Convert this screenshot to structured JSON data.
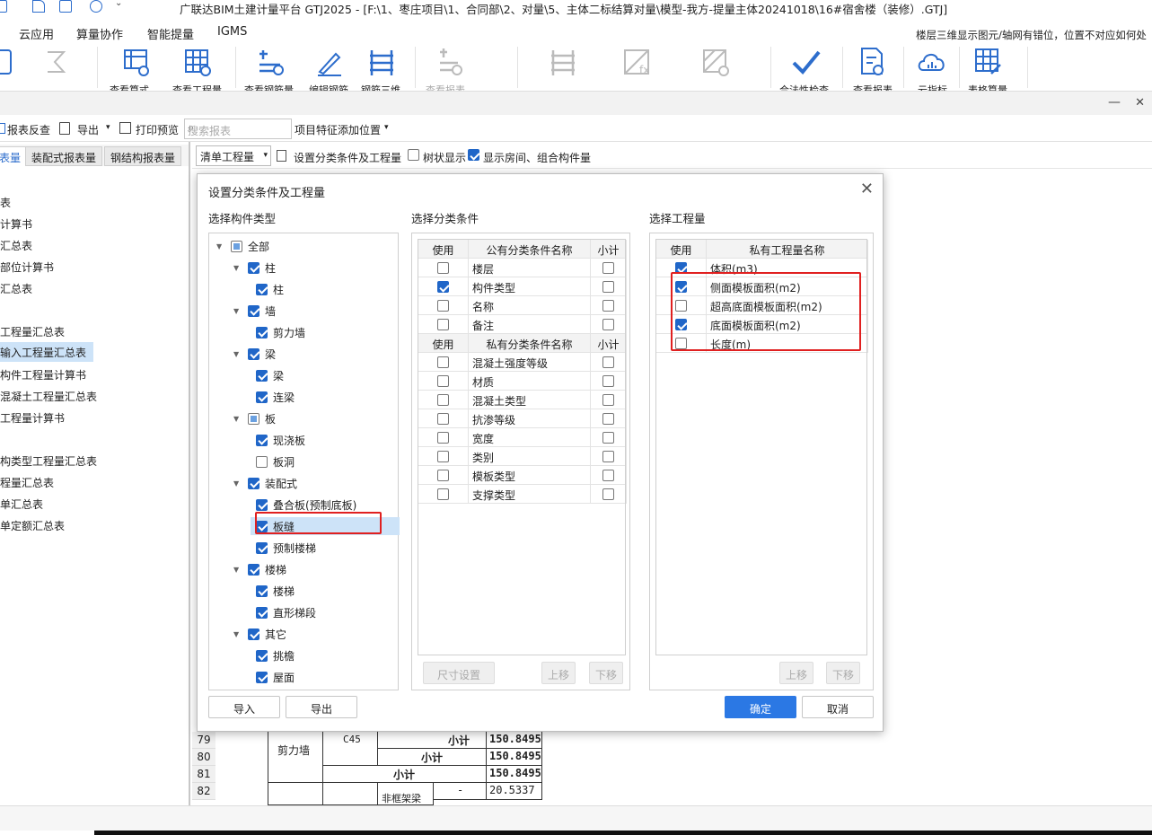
{
  "window": {
    "title": "广联达BIM土建计量平台 GTJ2025 - [F:\\1、枣庄项目\\1、合同部\\2、对量\\5、主体二标结算对量\\模型-我方-提量主体20241018\\16#宿舍楼（装修）.GTJ]"
  },
  "menu": {
    "items": [
      "云应用",
      "算量协作",
      "智能提量",
      "IGMS"
    ],
    "notice": "楼层三维显示图元/轴网有错位，位置不对应如何处"
  },
  "ribbon": {
    "labels": [
      "查看算式",
      "查看工程量",
      "查看钢筋量",
      "编辑钢筋",
      "钢筋三维",
      "查看报表",
      "合法性检查",
      "查看报表",
      "云指标",
      "表格算量"
    ]
  },
  "toolbar": {
    "report_check": "报表反查",
    "export": "导出",
    "print_preview": "打印预览",
    "search_placeholder": "搜索报表",
    "add_position": "项目特征添加位置"
  },
  "left_tabs": [
    "表量",
    "装配式报表量",
    "钢结构报表量"
  ],
  "left_list": [
    "表",
    "计算书",
    "汇总表",
    "部位计算书",
    "汇总表",
    "工程量汇总表",
    "输入工程量汇总表",
    "构件工程量计算书",
    "混凝土工程量汇总表",
    "工程量计算书",
    "构类型工程量汇总表",
    "程量汇总表",
    "单汇总表",
    "单定额汇总表"
  ],
  "right_toolbar": {
    "select_value": "清单工程量",
    "set_conditions": "设置分类条件及工程量",
    "tree_display": "树状显示",
    "show_rooms": "显示房间、组合构件量"
  },
  "bottom_table": {
    "row_numbers": [
      "79",
      "80",
      "81",
      "82"
    ],
    "r79": {
      "type": "剪力墙",
      "grade": "C45",
      "subtotal": "小计",
      "value": "150.8495"
    },
    "r80": {
      "subtotal": "小计",
      "value": "150.8495"
    },
    "r81": {
      "subtotal": "小计",
      "value": "150.8495"
    },
    "r82": {
      "type": "非框架梁",
      "dash": "-",
      "value": "20.5337"
    }
  },
  "dialog": {
    "title": "设置分类条件及工程量",
    "section_types": "选择构件类型",
    "section_conditions": "选择分类条件",
    "section_quantities": "选择工程量",
    "tree": [
      {
        "label": "全部",
        "level": 0,
        "state": "part",
        "arrow": true
      },
      {
        "label": "柱",
        "level": 1,
        "state": "on",
        "arrow": true
      },
      {
        "label": "柱",
        "level": 2,
        "state": "on"
      },
      {
        "label": "墙",
        "level": 1,
        "state": "on",
        "arrow": true
      },
      {
        "label": "剪力墙",
        "level": 2,
        "state": "on"
      },
      {
        "label": "梁",
        "level": 1,
        "state": "on",
        "arrow": true
      },
      {
        "label": "梁",
        "level": 2,
        "state": "on"
      },
      {
        "label": "连梁",
        "level": 2,
        "state": "on"
      },
      {
        "label": "板",
        "level": 1,
        "state": "part",
        "arrow": true
      },
      {
        "label": "现浇板",
        "level": 2,
        "state": "on"
      },
      {
        "label": "板洞",
        "level": 2,
        "state": "off"
      },
      {
        "label": "装配式",
        "level": 1,
        "state": "on",
        "arrow": true
      },
      {
        "label": "叠合板(预制底板)",
        "level": 2,
        "state": "on"
      },
      {
        "label": "板缝",
        "level": 2,
        "state": "on",
        "selected": true
      },
      {
        "label": "预制楼梯",
        "level": 2,
        "state": "on"
      },
      {
        "label": "楼梯",
        "level": 1,
        "state": "on",
        "arrow": true
      },
      {
        "label": "楼梯",
        "level": 2,
        "state": "on"
      },
      {
        "label": "直形梯段",
        "level": 2,
        "state": "on"
      },
      {
        "label": "其它",
        "level": 1,
        "state": "on",
        "arrow": true
      },
      {
        "label": "挑檐",
        "level": 2,
        "state": "on"
      },
      {
        "label": "屋面",
        "level": 2,
        "state": "on"
      }
    ],
    "cond_headers": {
      "use": "使用",
      "public_name": "公有分类条件名称",
      "private_name": "私有分类条件名称",
      "subtotal": "小计"
    },
    "public_conditions": [
      {
        "name": "楼层",
        "use": false
      },
      {
        "name": "构件类型",
        "use": true
      },
      {
        "name": "名称",
        "use": false
      },
      {
        "name": "备注",
        "use": false
      }
    ],
    "private_conditions": [
      {
        "name": "混凝土强度等级",
        "use": false
      },
      {
        "name": "材质",
        "use": false
      },
      {
        "name": "混凝土类型",
        "use": false
      },
      {
        "name": "抗渗等级",
        "use": false
      },
      {
        "name": "宽度",
        "use": false
      },
      {
        "name": "类别",
        "use": false
      },
      {
        "name": "模板类型",
        "use": false
      },
      {
        "name": "支撑类型",
        "use": false
      }
    ],
    "qty_headers": {
      "use": "使用",
      "name": "私有工程量名称"
    },
    "quantities": [
      {
        "name": "体积(m3)",
        "use": true
      },
      {
        "name": "侧面模板面积(m2)",
        "use": true
      },
      {
        "name": "超高底面模板面积(m2)",
        "use": false
      },
      {
        "name": "底面模板面积(m2)",
        "use": true
      },
      {
        "name": "长度(m)",
        "use": false
      }
    ],
    "buttons": {
      "size_setting": "尺寸设置",
      "up": "上移",
      "down": "下移",
      "up2": "上移",
      "down2": "下移",
      "import": "导入",
      "export": "导出",
      "ok": "确定",
      "cancel": "取消"
    }
  }
}
